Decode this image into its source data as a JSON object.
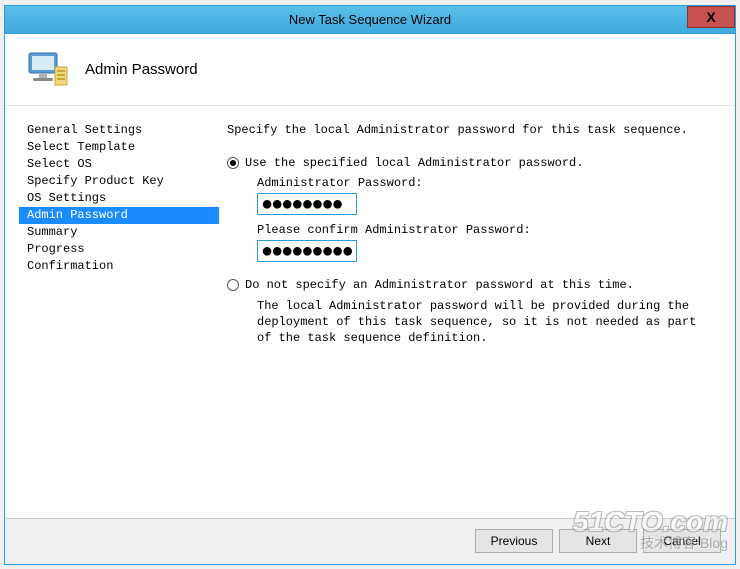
{
  "window": {
    "title": "New Task Sequence Wizard",
    "close_label": "X"
  },
  "header": {
    "title": "Admin Password"
  },
  "sidebar": {
    "items": [
      {
        "label": "General Settings",
        "selected": false
      },
      {
        "label": "Select Template",
        "selected": false
      },
      {
        "label": "Select OS",
        "selected": false
      },
      {
        "label": "Specify Product Key",
        "selected": false
      },
      {
        "label": "OS Settings",
        "selected": false
      },
      {
        "label": "Admin Password",
        "selected": true
      },
      {
        "label": "Summary",
        "selected": false
      },
      {
        "label": "Progress",
        "selected": false
      },
      {
        "label": "Confirmation",
        "selected": false
      }
    ]
  },
  "main": {
    "instruction": "Specify the local Administrator password for this task sequence.",
    "option1": {
      "label": "Use the specified local Administrator password.",
      "password_label": "Administrator Password:",
      "password_value": "●●●●●●●●",
      "confirm_label": "Please confirm Administrator Password:",
      "confirm_value": "●●●●●●●●●"
    },
    "option2": {
      "label": "Do not specify an Administrator password at this time.",
      "helper": "The local Administrator password will be provided during the deployment of this task sequence, so it is not needed as part of the task sequence definition."
    }
  },
  "footer": {
    "previous": "Previous",
    "next": "Next",
    "cancel": "Cancel"
  },
  "watermark": {
    "line1": "51CTO.com",
    "line2": "技术博客 Blog"
  }
}
